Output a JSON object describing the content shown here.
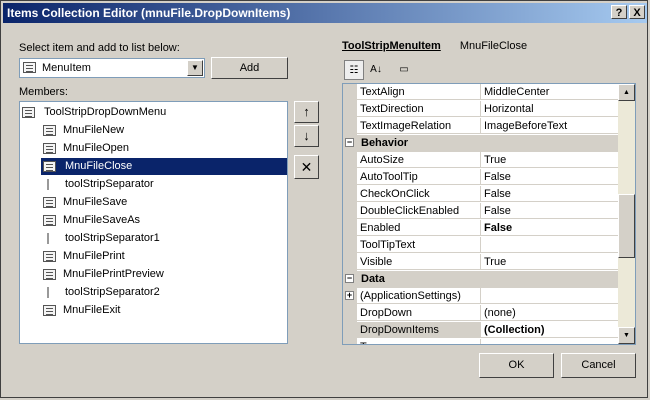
{
  "window": {
    "title": "Items Collection Editor (mnuFile.DropDownItems)",
    "help_button": "?",
    "close_button": "X"
  },
  "left": {
    "select_label": "Select item and add to list below:",
    "combo_value": "MenuItem",
    "add_label": "Add",
    "members_label": "Members:",
    "root": "ToolStripDropDownMenu",
    "items": [
      {
        "label": "MnuFileNew",
        "type": "menu"
      },
      {
        "label": "MnuFileOpen",
        "type": "menu"
      },
      {
        "label": "MnuFileClose",
        "type": "menu",
        "selected": true
      },
      {
        "label": "toolStripSeparator",
        "type": "separator"
      },
      {
        "label": "MnuFileSave",
        "type": "menu"
      },
      {
        "label": "MnuFileSaveAs",
        "type": "menu"
      },
      {
        "label": "toolStripSeparator1",
        "type": "separator"
      },
      {
        "label": "MnuFilePrint",
        "type": "menu"
      },
      {
        "label": "MnuFilePrintPreview",
        "type": "menu"
      },
      {
        "label": "toolStripSeparator2",
        "type": "separator"
      },
      {
        "label": "MnuFileExit",
        "type": "menu"
      }
    ],
    "move_up": "↑",
    "move_down": "↓",
    "remove": "✕"
  },
  "right": {
    "type_label": "ToolStripMenuItem",
    "object_name": "MnuFileClose",
    "rows": [
      {
        "kind": "prop",
        "name": "TextAlign",
        "value": "MiddleCenter"
      },
      {
        "kind": "prop",
        "name": "TextDirection",
        "value": "Horizontal"
      },
      {
        "kind": "prop",
        "name": "TextImageRelation",
        "value": "ImageBeforeText"
      },
      {
        "kind": "cat",
        "name": "Behavior"
      },
      {
        "kind": "prop",
        "name": "AutoSize",
        "value": "True"
      },
      {
        "kind": "prop",
        "name": "AutoToolTip",
        "value": "False"
      },
      {
        "kind": "prop",
        "name": "CheckOnClick",
        "value": "False"
      },
      {
        "kind": "prop",
        "name": "DoubleClickEnabled",
        "value": "False"
      },
      {
        "kind": "prop",
        "name": "Enabled",
        "value": "False",
        "bold": true
      },
      {
        "kind": "prop",
        "name": "ToolTipText",
        "value": ""
      },
      {
        "kind": "prop",
        "name": "Visible",
        "value": "True"
      },
      {
        "kind": "cat",
        "name": "Data"
      },
      {
        "kind": "prop",
        "name": "(ApplicationSettings)",
        "value": "",
        "expander": true
      },
      {
        "kind": "prop",
        "name": "DropDown",
        "value": "(none)"
      },
      {
        "kind": "prop",
        "name": "DropDownItems",
        "value": "(Collection)",
        "bold": true,
        "selected": true
      },
      {
        "kind": "prop",
        "name": "T",
        "value": ""
      }
    ]
  },
  "footer": {
    "ok_label": "OK",
    "cancel_label": "Cancel"
  }
}
